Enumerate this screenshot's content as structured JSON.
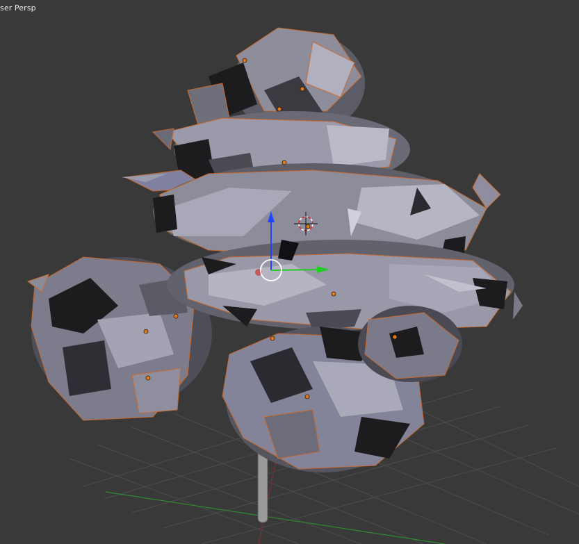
{
  "viewport": {
    "view_label": "ser Persp",
    "colors": {
      "background": "#393939",
      "grid": "#4c4c4c",
      "x_axis_line": "#2e8b2e",
      "mesh_light": "#a9a9b8",
      "mesh_mid": "#7d7d8a",
      "mesh_dark": "#1c1c1e",
      "selection_outline": "#c9692c",
      "origin_dot": "#e07a1c",
      "manipulator_z": "#2244ff",
      "manipulator_y": "#22cc22",
      "manipulator_x": "#cc3333",
      "trunk": "#9a9a9a"
    },
    "icons": {
      "cursor": "3d-cursor-icon",
      "manipulator": "transform-manipulator-icon"
    }
  }
}
